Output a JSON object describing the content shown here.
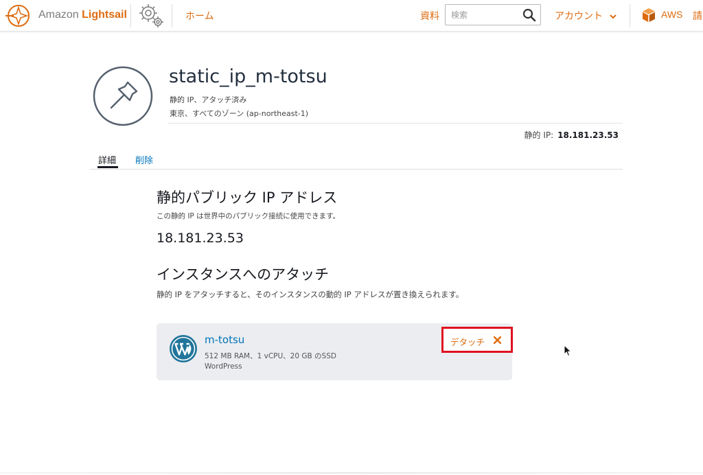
{
  "header": {
    "logo_prefix": "Amazon ",
    "logo_brand": "Lightsail",
    "home_link": "ホーム",
    "docs_link": "資料",
    "search_placeholder": "検索",
    "account_menu": "アカウント",
    "aws_link": "AWS",
    "cut_item": "請"
  },
  "resource": {
    "name": "static_ip_m-totsu",
    "status_line": "静的 IP、アタッチ済み",
    "location_line": "東京、すべてのゾーン (ap-northeast-1)",
    "ip_label": "静的 IP:",
    "ip_value": "18.181.23.53"
  },
  "tabs": [
    {
      "label": "詳細",
      "active": true
    },
    {
      "label": "削除",
      "active": false
    }
  ],
  "public_ip_section": {
    "heading": "静的パブリック IP アドレス",
    "description": "この静的 IP は世界中のパブリック接続に使用できます。",
    "value": "18.181.23.53"
  },
  "attach_section": {
    "heading": "インスタンスへのアタッチ",
    "description": "静的 IP をアタッチすると、そのインスタンスの動的 IP アドレスが置き換えられます。"
  },
  "instance": {
    "name": "m-totsu",
    "spec": "512 MB RAM、1 vCPU、20 GB のSSD",
    "blueprint": "WordPress",
    "detach_label": "デタッチ"
  },
  "colors": {
    "accent": "#dd6b10",
    "link": "#0073bb",
    "highlight_border": "#e0101f",
    "card_bg": "#ebedf0"
  }
}
